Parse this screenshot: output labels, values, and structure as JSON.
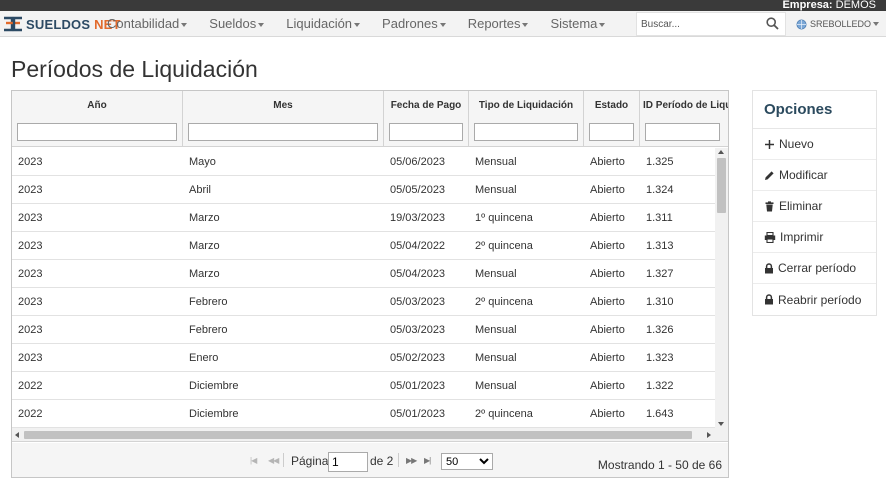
{
  "topbar": {
    "empresa_label": "Empresa:",
    "empresa_value": "DEMOS"
  },
  "brand": {
    "part1": "SUELDOS",
    "part2": "NET"
  },
  "nav": {
    "items": [
      "Contabilidad",
      "Sueldos",
      "Liquidación",
      "Padrones",
      "Reportes",
      "Sistema"
    ],
    "search_placeholder": "Buscar...",
    "user": "SREBOLLEDO"
  },
  "page": {
    "title": "Períodos de Liquidación"
  },
  "table": {
    "columns": [
      "Año",
      "Mes",
      "Fecha de Pago",
      "Tipo de Liquidación",
      "Estado",
      "ID Período de Liquidación"
    ],
    "rows": [
      [
        "2023",
        "Mayo",
        "05/06/2023",
        "Mensual",
        "Abierto",
        "1.325"
      ],
      [
        "2023",
        "Abril",
        "05/05/2023",
        "Mensual",
        "Abierto",
        "1.324"
      ],
      [
        "2023",
        "Marzo",
        "19/03/2023",
        "1º quincena",
        "Abierto",
        "1.311"
      ],
      [
        "2023",
        "Marzo",
        "05/04/2022",
        "2º quincena",
        "Abierto",
        "1.313"
      ],
      [
        "2023",
        "Marzo",
        "05/04/2023",
        "Mensual",
        "Abierto",
        "1.327"
      ],
      [
        "2023",
        "Febrero",
        "05/03/2023",
        "2º quincena",
        "Abierto",
        "1.310"
      ],
      [
        "2023",
        "Febrero",
        "05/03/2023",
        "Mensual",
        "Abierto",
        "1.326"
      ],
      [
        "2023",
        "Enero",
        "05/02/2023",
        "Mensual",
        "Abierto",
        "1.323"
      ],
      [
        "2022",
        "Diciembre",
        "05/01/2023",
        "Mensual",
        "Abierto",
        "1.322"
      ],
      [
        "2022",
        "Diciembre",
        "05/01/2023",
        "2º quincena",
        "Abierto",
        "1.643"
      ]
    ]
  },
  "pager": {
    "page_label": "Página",
    "page_value": "1",
    "of_label": "de 2",
    "page_size": "50",
    "page_size_options": [
      "50"
    ],
    "info": "Mostrando 1 - 50 de 66"
  },
  "options": {
    "title": "Opciones",
    "items": [
      {
        "label": "Nuevo",
        "icon": "plus-icon"
      },
      {
        "label": "Modificar",
        "icon": "pencil-icon"
      },
      {
        "label": "Eliminar",
        "icon": "trash-icon"
      },
      {
        "label": "Imprimir",
        "icon": "printer-icon"
      },
      {
        "label": "Cerrar período",
        "icon": "lock-icon"
      },
      {
        "label": "Reabrir período",
        "icon": "lock-icon"
      }
    ]
  },
  "colors": {
    "topstrip": "#3a3a3a",
    "brand_dark": "#2c4a64",
    "brand_accent": "#e26a2c",
    "options_title": "#2b4a5e"
  }
}
